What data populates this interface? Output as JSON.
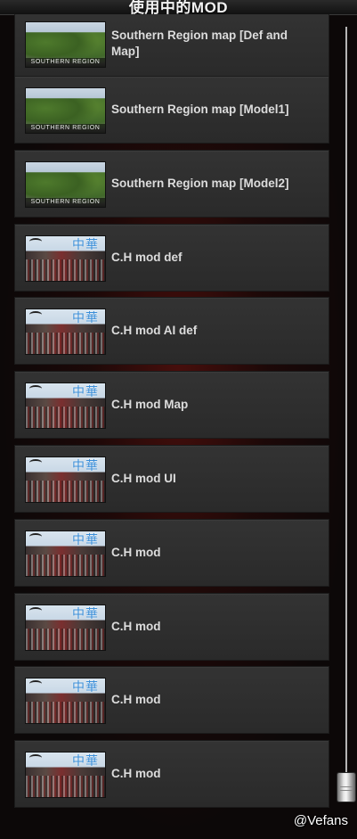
{
  "window": {
    "title": "使用中的MOD"
  },
  "mod_list": {
    "items": [
      {
        "label": "Southern Region map [Def and Map]",
        "thumbnail": "southern",
        "thumb_text": "SOUTHERN REGION"
      },
      {
        "label": "Southern Region map [Model1]",
        "thumbnail": "southern",
        "thumb_text": "SOUTHERN REGION"
      },
      {
        "label": "Southern Region map [Model2]",
        "thumbnail": "southern",
        "thumb_text": "SOUTHERN REGION"
      },
      {
        "label": "C.H mod def",
        "thumbnail": "ch",
        "thumb_text": "中華"
      },
      {
        "label": "C.H mod AI def",
        "thumbnail": "ch",
        "thumb_text": "中華"
      },
      {
        "label": "C.H mod Map",
        "thumbnail": "ch",
        "thumb_text": "中華"
      },
      {
        "label": "C.H mod UI",
        "thumbnail": "ch",
        "thumb_text": "中華"
      },
      {
        "label": "C.H mod",
        "thumbnail": "ch",
        "thumb_text": "中華"
      },
      {
        "label": "C.H mod",
        "thumbnail": "ch",
        "thumb_text": "中華"
      },
      {
        "label": "C.H mod",
        "thumbnail": "ch",
        "thumb_text": "中華"
      },
      {
        "label": "C.H mod",
        "thumbnail": "ch",
        "thumb_text": "中華"
      }
    ]
  },
  "scrollbar": {
    "position_fraction": 1.0
  },
  "watermark": "@Vefans"
}
